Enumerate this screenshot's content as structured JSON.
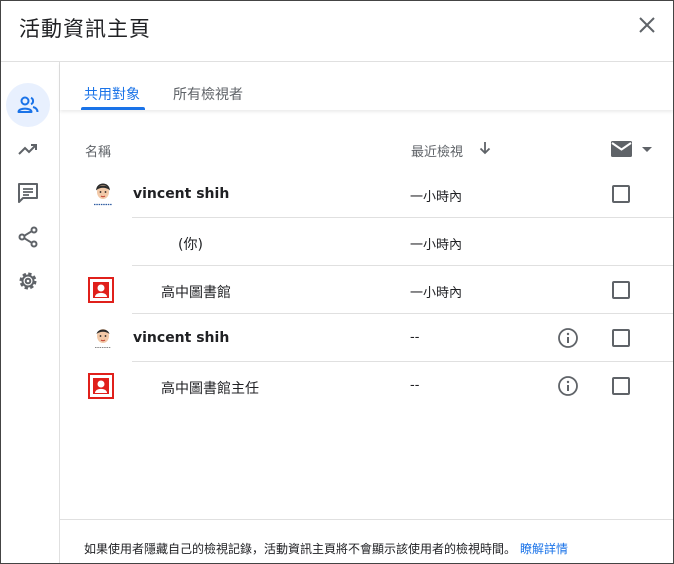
{
  "dialog": {
    "title": "活動資訊主頁"
  },
  "tabs": [
    {
      "label": "共用對象",
      "active": true
    },
    {
      "label": "所有檢視者",
      "active": false
    }
  ],
  "side_rail": [
    {
      "icon": "people-icon",
      "active": true
    },
    {
      "icon": "trending-up-icon",
      "active": false
    },
    {
      "icon": "comment-icon",
      "active": false
    },
    {
      "icon": "share-icon",
      "active": false
    },
    {
      "icon": "gear-icon",
      "active": false
    }
  ],
  "table": {
    "headers": {
      "name": "名稱",
      "last_viewed": "最近檢視"
    },
    "rows": [
      {
        "avatar": "student-avatar-icon",
        "name": "vincent shih",
        "bold": true,
        "last_viewed": "一小時內",
        "info": false,
        "checkbox": true
      },
      {
        "avatar": "",
        "name": "(你)",
        "bold": false,
        "last_viewed": "一小時內",
        "info": false,
        "checkbox": false
      },
      {
        "avatar": "library-avatar-icon",
        "name": "高中圖書館",
        "bold": false,
        "last_viewed": "一小時內",
        "info": false,
        "checkbox": true
      },
      {
        "avatar": "teacher-avatar-icon",
        "name": "vincent shih",
        "bold": true,
        "last_viewed": "--",
        "info": true,
        "checkbox": true
      },
      {
        "avatar": "library-avatar-icon",
        "name": "高中圖書館主任",
        "bold": false,
        "last_viewed": "--",
        "info": true,
        "checkbox": true
      }
    ]
  },
  "footer": {
    "text": "如果使用者隱藏自己的檢視記錄，活動資訊主頁將不會顯示該使用者的檢視時間。",
    "link": "瞭解詳情"
  },
  "colors": {
    "accent": "#1a73e8",
    "icon": "#5f6368",
    "active_bg": "#e8f0fe"
  }
}
